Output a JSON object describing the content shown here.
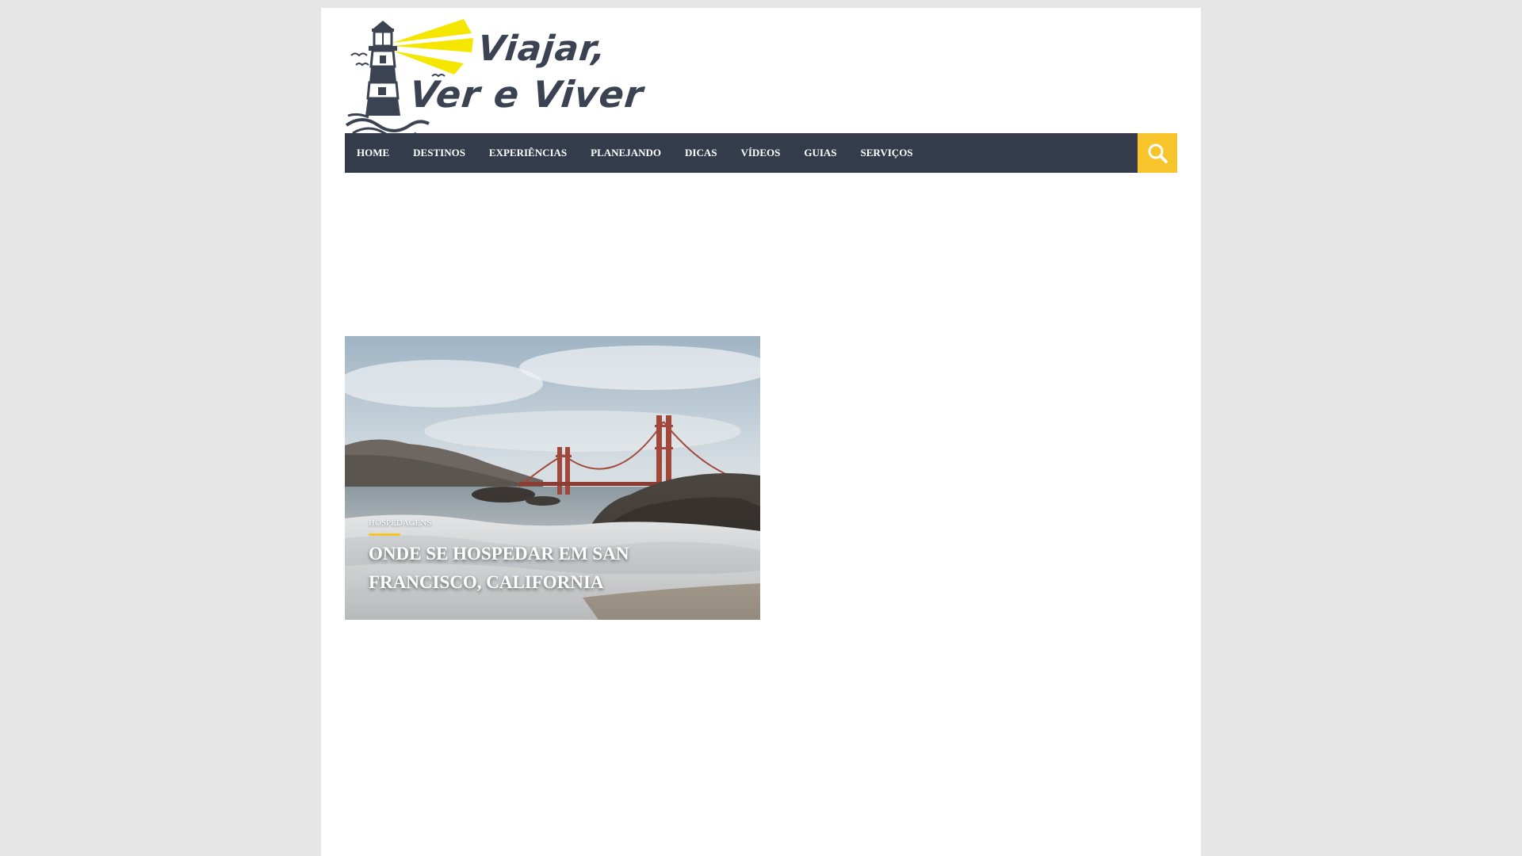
{
  "logo": {
    "line1": "Viajar,",
    "line2": "Ver e Viver"
  },
  "nav": {
    "items": [
      {
        "label": "HOME"
      },
      {
        "label": "DESTINOS"
      },
      {
        "label": "EXPERIÊNCIAS"
      },
      {
        "label": "PLANEJANDO"
      },
      {
        "label": "DICAS"
      },
      {
        "label": "VÍDEOS"
      },
      {
        "label": "GUIAS"
      },
      {
        "label": "SERVIÇOS"
      }
    ],
    "search_icon": "search-icon"
  },
  "featured": {
    "category": "HOSPEDAGENS",
    "title": "ONDE SE HOSPEDAR EM SAN FRANCISCO, CALIFORNIA"
  },
  "colors": {
    "nav_bg": "#343b4a",
    "accent": "#f7c52b",
    "logo_text": "#3b4251",
    "page_bg": "#e6e6e6"
  }
}
